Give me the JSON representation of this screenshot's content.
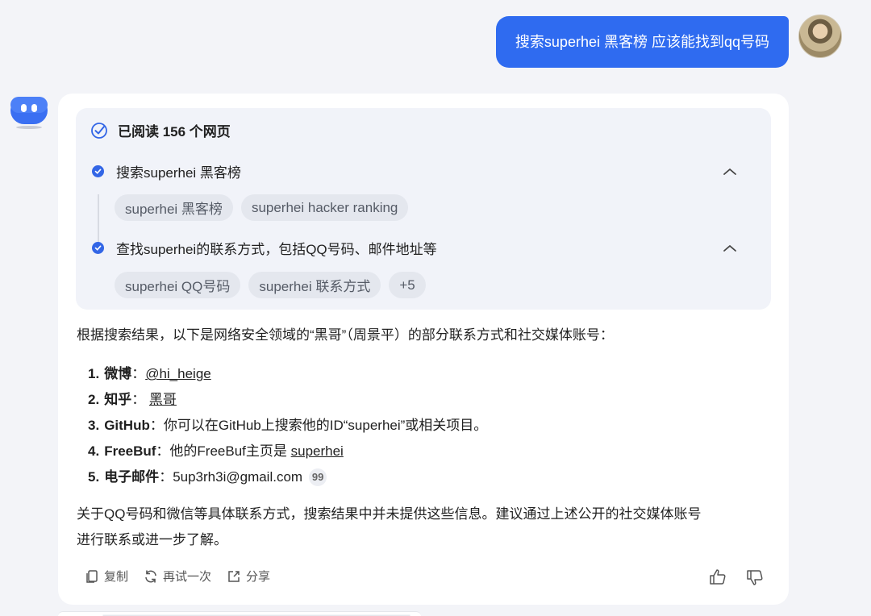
{
  "user_message": "搜索superhei 黑客榜 应该能找到qq号码",
  "reading": {
    "title": "已阅读 156 个网页",
    "steps": [
      {
        "label": "搜索superhei 黑客榜",
        "chips": [
          "superhei 黑客榜",
          "superhei hacker ranking"
        ]
      },
      {
        "label": "查找superhei的联系方式，包括QQ号码、邮件地址等",
        "chips": [
          "superhei QQ号码",
          "superhei 联系方式",
          "+5"
        ]
      }
    ]
  },
  "answer": {
    "intro": "根据搜索结果，以下是网络安全领域的“黑哥”（周景平）的部分联系方式和社交媒体账号：",
    "items": [
      {
        "num": "1.",
        "key": "微博",
        "sep": "：",
        "text": "",
        "link": "@hi_heige"
      },
      {
        "num": "2.",
        "key": "知乎",
        "sep": "：",
        "text": " ",
        "link": "黑哥"
      },
      {
        "num": "3.",
        "key": "GitHub",
        "sep": "：",
        "text": "你可以在GitHub上搜索他的ID“superhei”或相关项目。",
        "link": ""
      },
      {
        "num": "4.",
        "key": "FreeBuf",
        "sep": "：",
        "text": "他的FreeBuf主页是 ",
        "link": "superhei"
      },
      {
        "num": "5.",
        "key": "电子邮件",
        "sep": "：",
        "text": "5up3rh3i@gmail.com",
        "link": ""
      }
    ],
    "quote_mark": "99",
    "closing_line1": "关于QQ号码和微信等具体联系方式，搜索结果中并未提供这些信息。建议通过上述公开的社交媒体账号",
    "closing_line2": "进行联系或进一步了解。"
  },
  "actions": {
    "copy": "复制",
    "retry": "再试一次",
    "share": "分享"
  },
  "colors": {
    "accent": "#2f6bf0",
    "step_dot": "#3366e6"
  }
}
